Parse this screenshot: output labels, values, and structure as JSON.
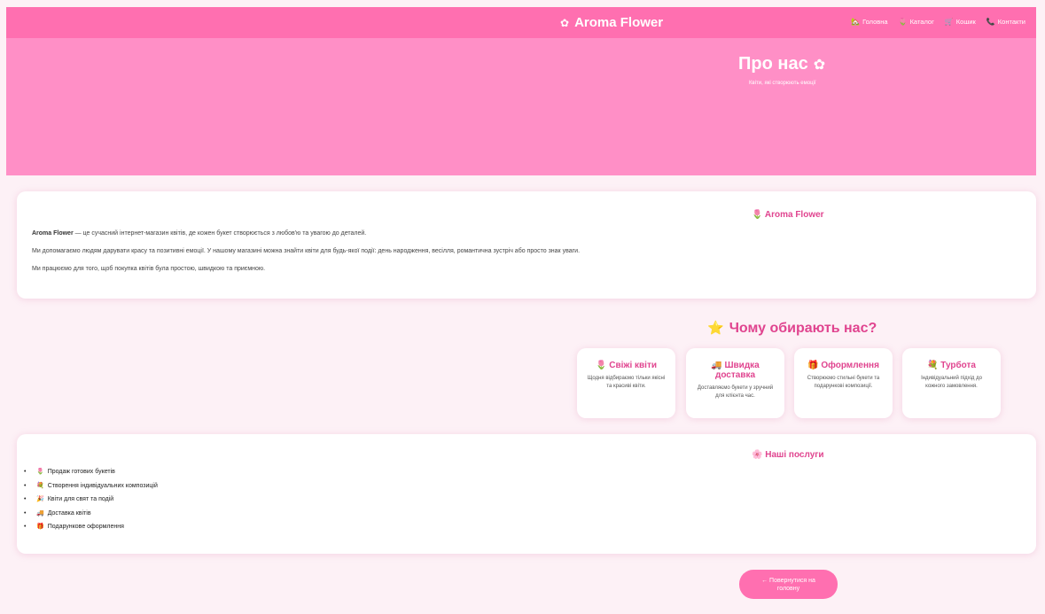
{
  "header": {
    "logo_icon": "✿",
    "brand": "Aroma Flower",
    "nav": [
      {
        "icon": "🏡",
        "label": "Головна"
      },
      {
        "icon": "🌷",
        "label": "Каталог"
      },
      {
        "icon": "🛒",
        "label": "Кошик"
      },
      {
        "icon": "📞",
        "label": "Контакти"
      }
    ]
  },
  "hero": {
    "title": "Про нас",
    "title_icon": "✿",
    "subtitle": "Квіти, які створюють емоції"
  },
  "about": {
    "heading_icon": "🌷",
    "heading": "Aroma Flower",
    "p1_strong": "Aroma Flower",
    "p1_rest": " — це сучасний інтернет-магазин квітів, де кожен букет створюється з любов'ю та увагою до деталей.",
    "p2": "Ми допомагаємо людям дарувати красу та позитивні емоції. У нашому магазині можна знайти квіти для будь-якої події: день народження, весілля, романтична зустріч або просто знак уваги.",
    "p3": "Ми працюємо для того, щоб покупка квітів була простою, швидкою та приємною."
  },
  "why": {
    "icon": "⭐",
    "title": "Чому обирають нас?",
    "features": [
      {
        "icon": "🌷",
        "title": "Свіжі квіти",
        "desc": "Щодня відбираємо тільки якісні та красиві квіти."
      },
      {
        "icon": "🚚",
        "title": "Швидка доставка",
        "desc": "Доставляємо букети у зручний для клієнта час."
      },
      {
        "icon": "🎁",
        "title": "Оформлення",
        "desc": "Створюємо стильні букети та подарункові композиції."
      },
      {
        "icon": "💐",
        "title": "Турбота",
        "desc": "Індивідуальний підхід до кожного замовлення."
      }
    ]
  },
  "services": {
    "heading_icon": "🌸",
    "heading": "Наші послуги",
    "items": [
      {
        "icon": "🌷",
        "label": "Продаж готових букетів"
      },
      {
        "icon": "💐",
        "label": "Створення індивідуальних композицій"
      },
      {
        "icon": "🎉",
        "label": "Квіти для свят та подій"
      },
      {
        "icon": "🚚",
        "label": "Доставка квітів"
      },
      {
        "icon": "🎁",
        "label": "Подарункове оформлення"
      }
    ]
  },
  "back_button": "← Повернутися на головну",
  "colors": {
    "accent": "#ff6fb0",
    "hero": "#ff8fc6",
    "heading": "#e0448f",
    "page_bg": "#fdf1f6"
  }
}
